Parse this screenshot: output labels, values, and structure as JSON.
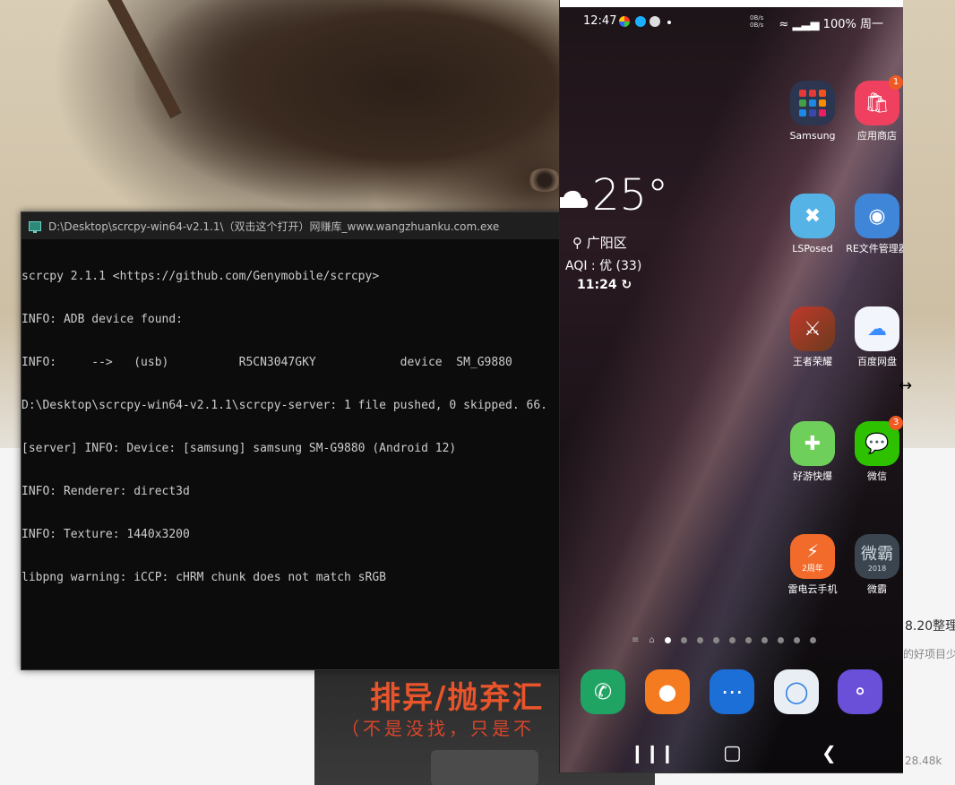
{
  "console": {
    "title": "D:\\Desktop\\scrcpy-win64-v2.1.1\\（双击这个打开）网赚库_www.wangzhuanku.com.exe",
    "lines": [
      "scrcpy 2.1.1 <https://github.com/Genymobile/scrcpy>",
      "INFO: ADB device found:",
      "INFO:     -->   (usb)          R5CN3047GKY            device  SM_G9880",
      "D:\\Desktop\\scrcpy-win64-v2.1.1\\scrcpy-server: 1 file pushed, 0 skipped. 66.",
      "[server] INFO: Device: [samsung] samsung SM-G9880 (Android 12)",
      "INFO: Renderer: direct3d",
      "INFO: Texture: 1440x3200",
      "libpng warning: iCCP: cHRM chunk does not match sRGB"
    ]
  },
  "phone": {
    "status": {
      "time": "12:47",
      "net_speed_top": "0B/s",
      "net_speed_bottom": "0B/s",
      "battery": "100%",
      "day": "周一"
    },
    "weather": {
      "temperature": "25°",
      "location": "广阳区",
      "aqi": "AQI : 优 (33)",
      "updated": "11:24"
    },
    "apps": [
      {
        "label": "Samsung",
        "badge": ""
      },
      {
        "label": "应用商店",
        "badge": "1"
      },
      {
        "label": "LSPosed",
        "badge": ""
      },
      {
        "label": "RE文件管理器",
        "badge": ""
      },
      {
        "label": "王者荣耀",
        "badge": ""
      },
      {
        "label": "百度网盘",
        "badge": ""
      },
      {
        "label": "好游快爆",
        "badge": ""
      },
      {
        "label": "微信",
        "badge": "3"
      },
      {
        "label": "雷电云手机",
        "badge": ""
      },
      {
        "label": "微霸",
        "badge": ""
      }
    ],
    "weiba_icon_text": "微霸",
    "weiba_icon_year": "2018",
    "leidian_icon_text": "2周年"
  },
  "web": {
    "banner_title": "排异/抛弃汇",
    "banner_sub": "（不是没找，只是不",
    "side_title": "8.20整理",
    "side_sub": "的好项目少",
    "views": "28.48k"
  },
  "colors": {
    "console_bg": "#0c0c0c",
    "console_text": "#cccccc",
    "badge": "#f05a22"
  }
}
